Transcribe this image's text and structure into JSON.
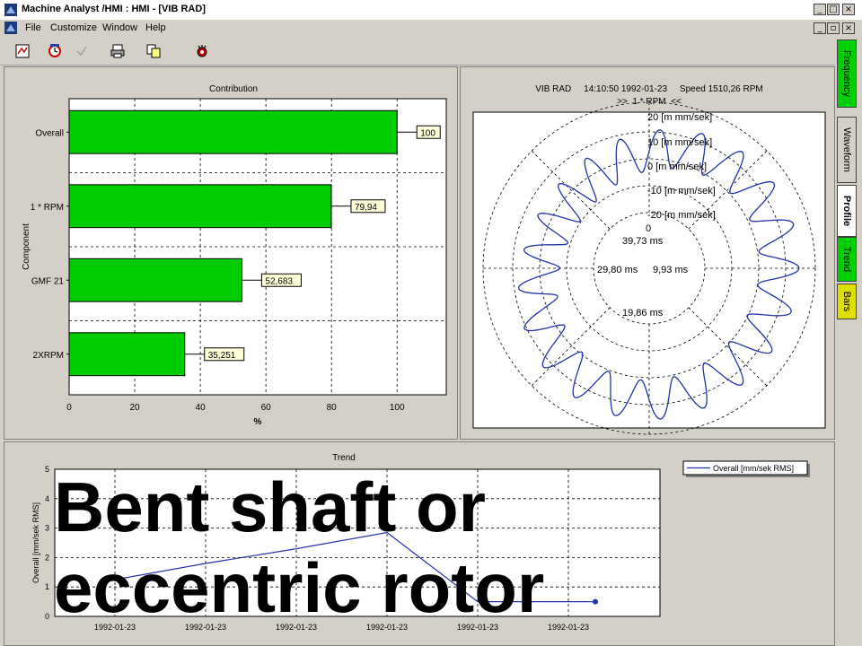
{
  "window": {
    "title": "Machine Analyst /HMI : HMI - [VIB RAD]",
    "buttons": [
      "_",
      "□",
      "×"
    ],
    "child_buttons": [
      "_",
      "▫",
      "×"
    ]
  },
  "menu": {
    "items": [
      "File",
      "Customize",
      "Window",
      "Help"
    ]
  },
  "toolbar": {
    "icons": [
      "report-icon",
      "refresh-icon",
      "check-icon",
      "print-icon",
      "copy-icon",
      "settings-icon"
    ]
  },
  "side_tabs": [
    {
      "label": "Frequency",
      "color": "#00d000",
      "active": false
    },
    {
      "label": "Waveform",
      "color": "#d4d0c8",
      "active": false
    },
    {
      "label": "Profile",
      "color": "#ffffff",
      "active": true
    },
    {
      "label": "Trend",
      "color": "#00d000",
      "active": false
    },
    {
      "label": "Bars",
      "color": "#e0e000",
      "active": false
    }
  ],
  "contribution": {
    "chart_data": {
      "type": "bar",
      "title": "Contribution",
      "xlabel": "%",
      "ylabel": "Component",
      "categories": [
        "Overall",
        "1 * RPM",
        "GMF 21",
        "2XRPM"
      ],
      "values": [
        100,
        79.94,
        52.683,
        35.251
      ],
      "value_labels": [
        "100",
        "79,94",
        "52,683",
        "35,251"
      ],
      "xlim": [
        0,
        115
      ],
      "xticks": [
        "0",
        "20",
        "40",
        "60",
        "80",
        "100"
      ],
      "bar_color": "#00cc00",
      "grid": true
    }
  },
  "profile": {
    "header_line1": "VIB RAD     14:10:50 1992-01-23     Speed 1510,26 RPM",
    "header_line2": ">>  1 * RPM  <<",
    "ring_labels": [
      "20 [m mm/sek]",
      "10 [m mm/sek]",
      "0 [m mm/sek]",
      "-10 [m mm/sek]",
      "-20 [m mm/sek]"
    ],
    "center_zero": "0",
    "time_labels": [
      "39,73 ms",
      "29,80 ms",
      "9,93 ms",
      "19,86 ms"
    ],
    "line_color": "#2233aa"
  },
  "trend": {
    "chart_data": {
      "type": "line",
      "title": "Trend",
      "ylabel": "Overall [mm/sek RMS]",
      "ylim": [
        0,
        5
      ],
      "yticks": [
        "0",
        "1",
        "2",
        "3",
        "4",
        "5"
      ],
      "categories": [
        "1992-01-23",
        "1992-01-23",
        "1992-01-23",
        "1992-01-23",
        "1992-01-23",
        "1992-01-23"
      ],
      "series": [
        {
          "name": "Overall [mm/sek RMS]",
          "values": [
            1.25,
            1.8,
            2.3,
            2.85,
            0.5,
            0.5
          ]
        }
      ],
      "line_color": "#2233aa",
      "grid": true
    }
  },
  "overlay": {
    "line1": "Bent shaft or",
    "line2": "eccentric rotor"
  }
}
